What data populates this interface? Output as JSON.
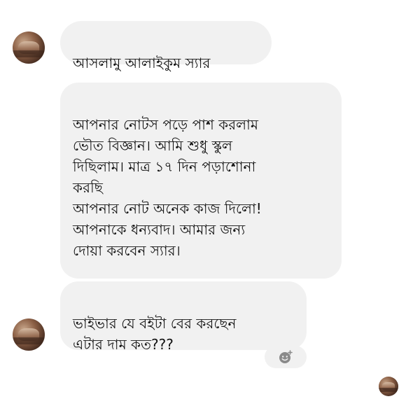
{
  "messages": [
    {
      "text": "আসলামু আলাইকুম স্যার"
    },
    {
      "text": "আপনার নোটস পড়ে পাশ করলাম\nভৌত বিজ্ঞান। আমি শুধু স্কুল\nদিছিলাম। মাত্র ১৭ দিন পড়াশোনা\nকরছি\nআপনার নোট অনেক কাজ দিলো!\nআপনাকে ধন্যবাদ। আমার জন্য\nদোয়া করবেন স্যার।"
    },
    {
      "text": "ভাইভার যে বইটা বের করছেন\nএটার দাম কত???"
    }
  ],
  "icons": {
    "reaction": "add-reaction-icon",
    "avatar": "avatar"
  }
}
